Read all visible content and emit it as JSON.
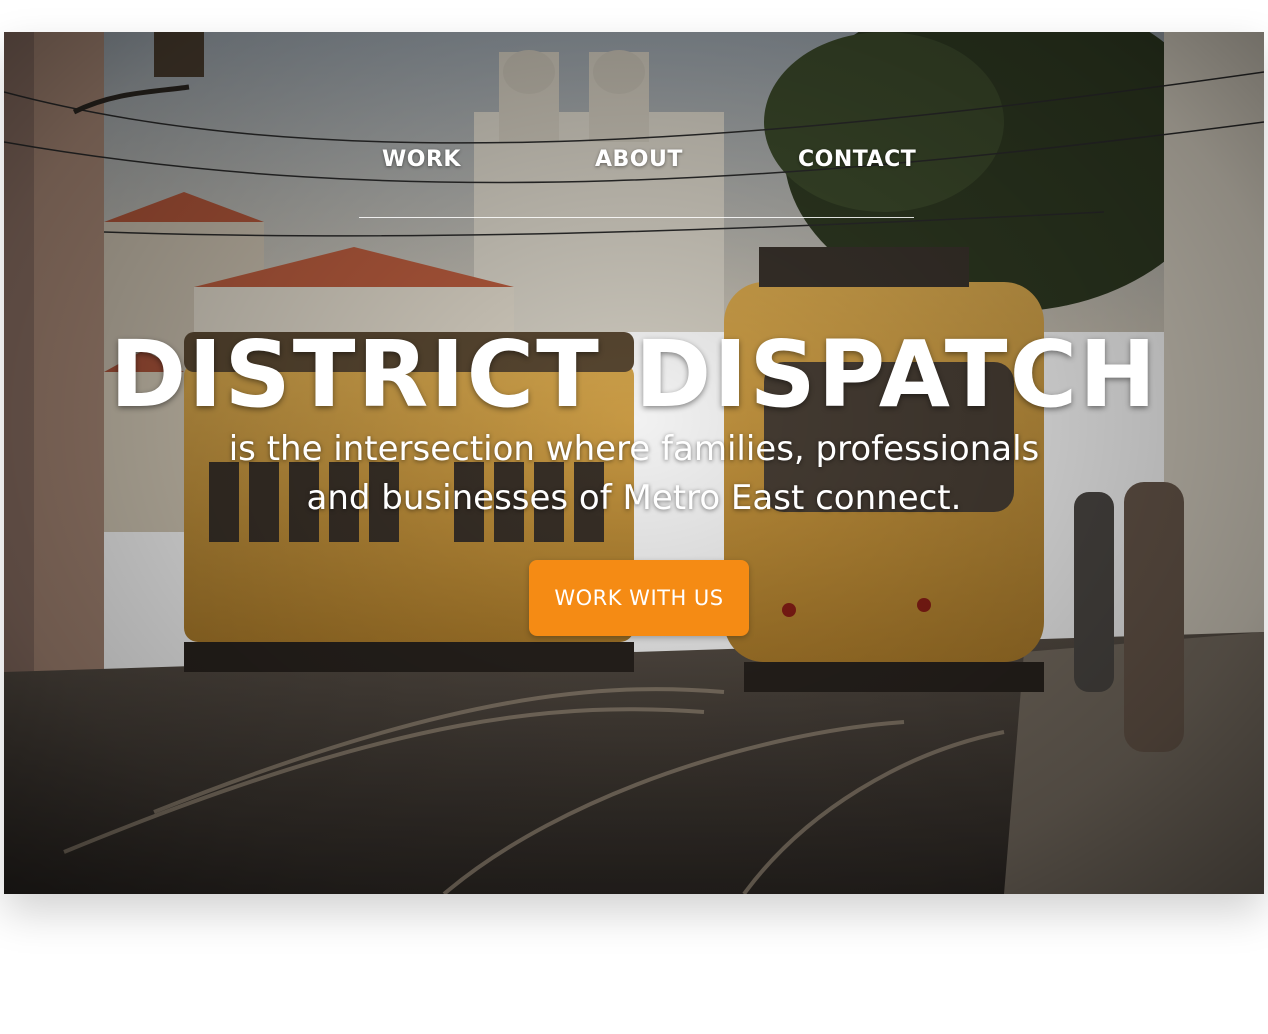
{
  "nav": {
    "items": [
      {
        "label": "WORK"
      },
      {
        "label": "ABOUT"
      },
      {
        "label": "CONTACT"
      }
    ]
  },
  "hero": {
    "title": "DISTRICT DISPATCH",
    "subtitle": "is the intersection where families, professionals and businesses of Metro East connect.",
    "cta_label": "WORK WITH US",
    "background_image": "street-trams-photo"
  },
  "colors": {
    "accent": "#f58b14",
    "text": "#ffffff"
  }
}
